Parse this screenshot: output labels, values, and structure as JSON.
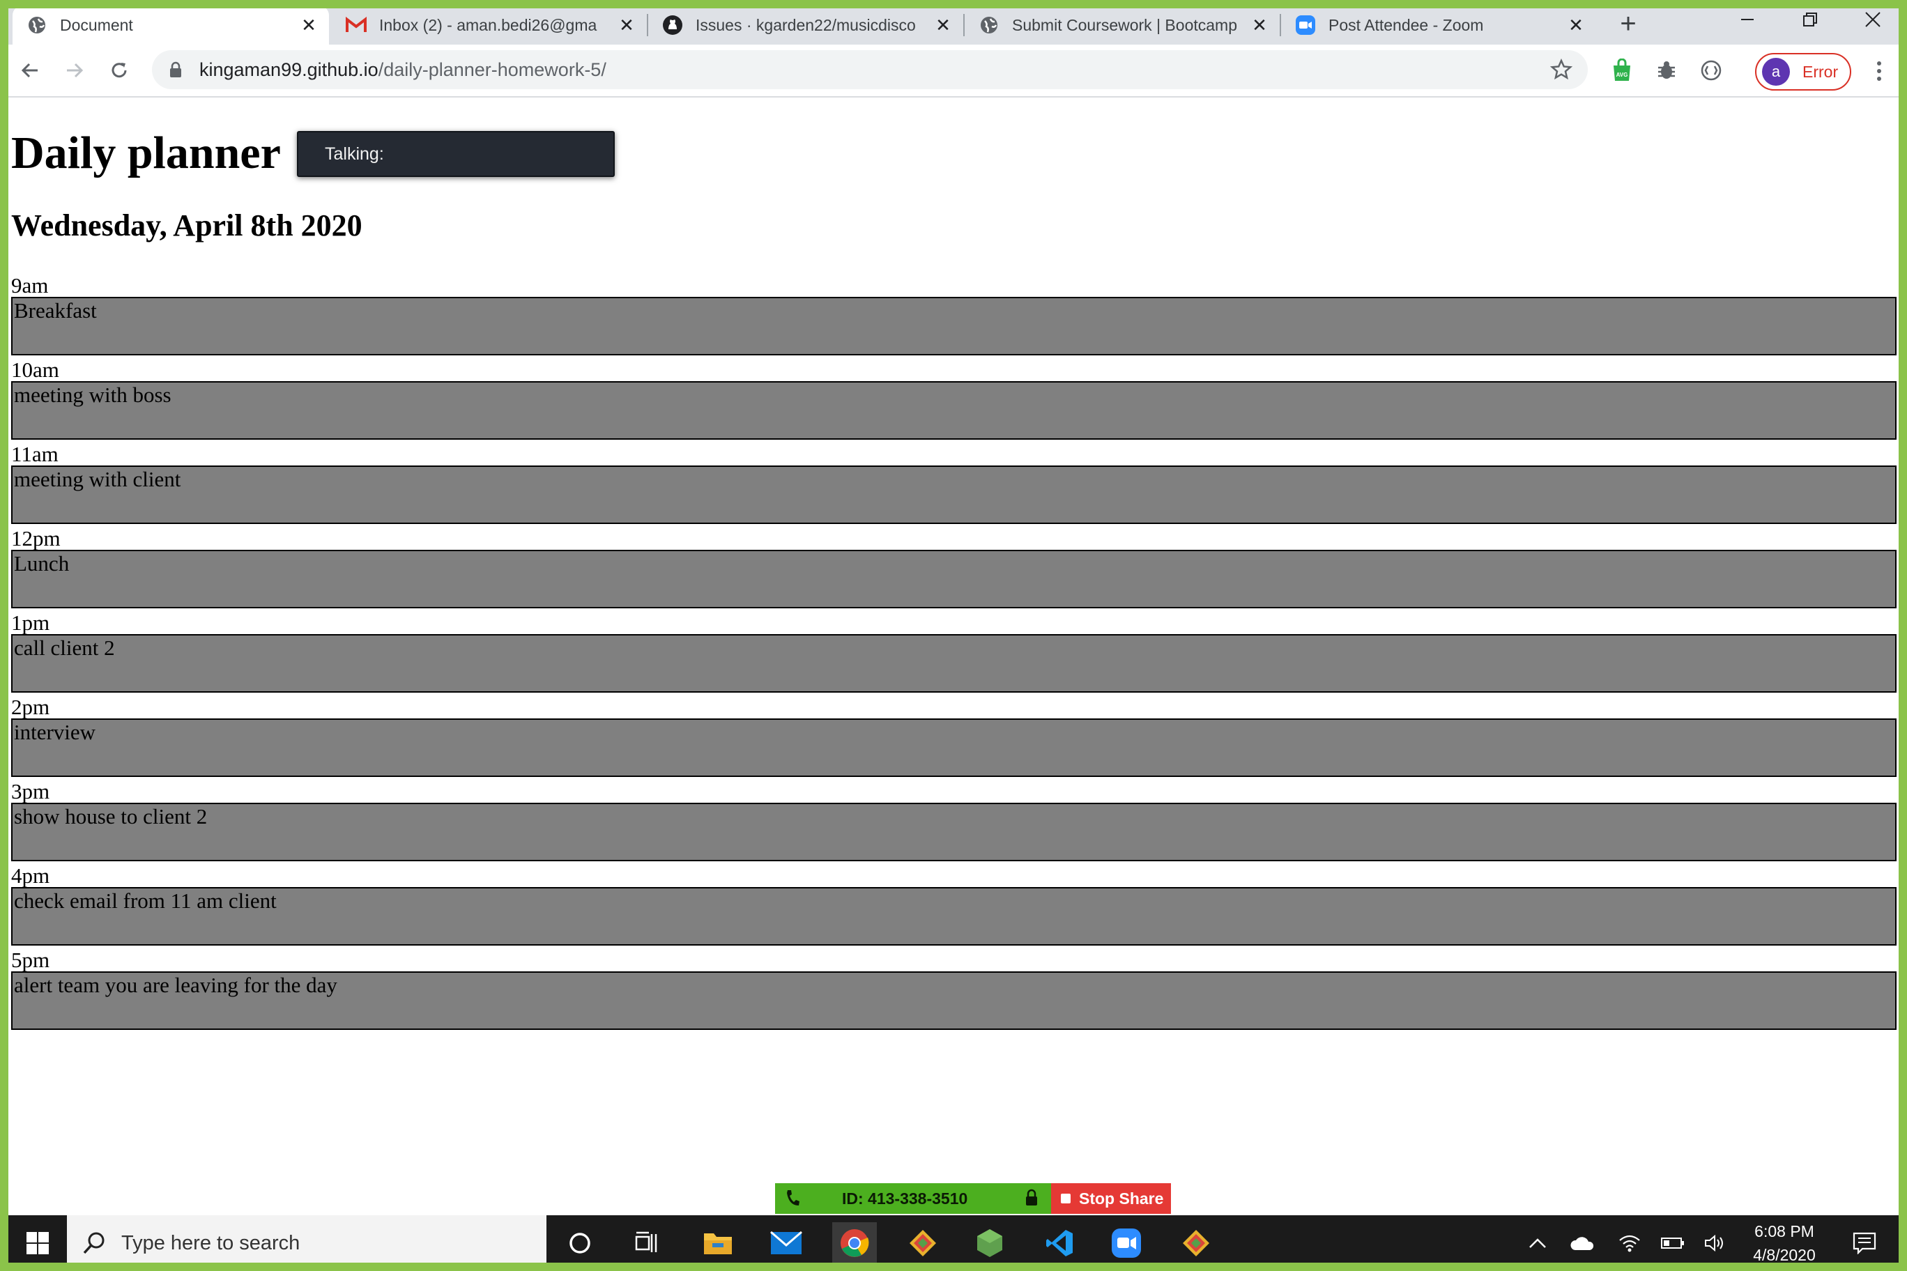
{
  "browser": {
    "tabs": [
      {
        "title": "Document",
        "icon": "globe-icon",
        "active": true
      },
      {
        "title": "Inbox (2) - aman.bedi26@gma",
        "icon": "gmail-icon",
        "active": false
      },
      {
        "title": "Issues · kgarden22/musicdisco",
        "icon": "github-icon",
        "active": false
      },
      {
        "title": "Submit Coursework | Bootcamp",
        "icon": "globe-icon",
        "active": false
      },
      {
        "title": "Post Attendee - Zoom",
        "icon": "zoom-icon",
        "active": false
      }
    ],
    "url_host": "kingaman99.github.io",
    "url_path": "/daily-planner-homework-5/",
    "profile_initial": "a",
    "profile_status": "Error"
  },
  "page": {
    "title": "Daily planner",
    "date": "Wednesday, April 8th 2020",
    "tooltip_label": "Talking:",
    "hours": [
      {
        "label": "9am",
        "text": "Breakfast"
      },
      {
        "label": "10am",
        "text": "meeting with boss"
      },
      {
        "label": "11am",
        "text": "meeting with client"
      },
      {
        "label": "12pm",
        "text": "Lunch"
      },
      {
        "label": "1pm",
        "text": "call client 2"
      },
      {
        "label": "2pm",
        "text": "interview"
      },
      {
        "label": "3pm",
        "text": "show house to client 2"
      },
      {
        "label": "4pm",
        "text": "check email from 11 am client"
      },
      {
        "label": "5pm",
        "text": "alert team you are leaving for the day"
      }
    ]
  },
  "zoom": {
    "meeting_id": "ID: 413-338-3510",
    "stop_share": "Stop Share"
  },
  "taskbar": {
    "search_placeholder": "Type here to search",
    "time": "6:08 PM",
    "date": "4/8/2020"
  },
  "colors": {
    "textarea_bg": "#808080",
    "zoom_green": "#4caf1f",
    "zoom_red": "#e53935",
    "share_border": "#8bc34a"
  }
}
